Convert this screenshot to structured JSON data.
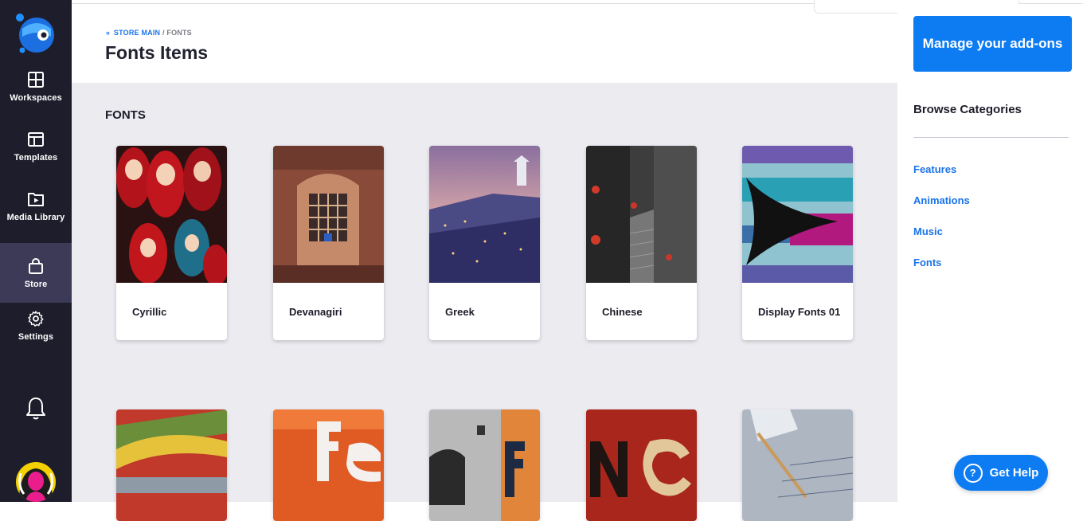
{
  "sidebar": {
    "items": [
      {
        "label": "Workspaces",
        "icon": "grid-icon"
      },
      {
        "label": "Templates",
        "icon": "layout-icon"
      },
      {
        "label": "Media Library",
        "icon": "media-play-icon"
      },
      {
        "label": "Store",
        "icon": "shopping-bag-icon",
        "active": true
      },
      {
        "label": "Settings",
        "icon": "gear-icon"
      }
    ]
  },
  "header": {
    "breadcrumb": {
      "chevron": "«",
      "parent": "STORE MAIN",
      "separator": "/",
      "current": "FONTS"
    },
    "title": "Fonts Items"
  },
  "main": {
    "section_title": "FONTS",
    "cards": [
      {
        "name": "Cyrillic"
      },
      {
        "name": "Devanagiri"
      },
      {
        "name": "Greek"
      },
      {
        "name": "Chinese"
      },
      {
        "name": "Display Fonts 01"
      }
    ],
    "second_row_count": 5
  },
  "right_panel": {
    "manage_button": "Manage your add-ons",
    "browse_title": "Browse Categories",
    "categories": [
      "Features",
      "Animations",
      "Music",
      "Fonts"
    ]
  },
  "help": {
    "label": "Get Help",
    "icon": "question-circle-icon"
  },
  "colors": {
    "sidebar_bg": "#1e1d2b",
    "sidebar_active": "#3c3a57",
    "accent": "#0d7cf2",
    "link": "#1a73e8",
    "main_bg": "#ebebf0"
  }
}
